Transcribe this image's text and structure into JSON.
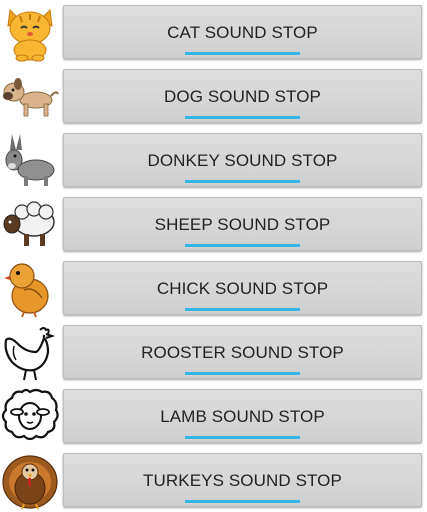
{
  "accent_color": "#33b5e5",
  "items": [
    {
      "label": "CAT SOUND STOP",
      "icon": "cat-icon"
    },
    {
      "label": "DOG SOUND STOP",
      "icon": "dog-icon"
    },
    {
      "label": "DONKEY SOUND STOP",
      "icon": "donkey-icon"
    },
    {
      "label": "SHEEP SOUND STOP",
      "icon": "sheep-icon"
    },
    {
      "label": "CHICK SOUND STOP",
      "icon": "chick-icon"
    },
    {
      "label": "ROOSTER SOUND STOP",
      "icon": "rooster-icon"
    },
    {
      "label": "LAMB SOUND STOP",
      "icon": "lamb-icon"
    },
    {
      "label": "TURKEYS SOUND STOP",
      "icon": "turkey-icon"
    }
  ]
}
